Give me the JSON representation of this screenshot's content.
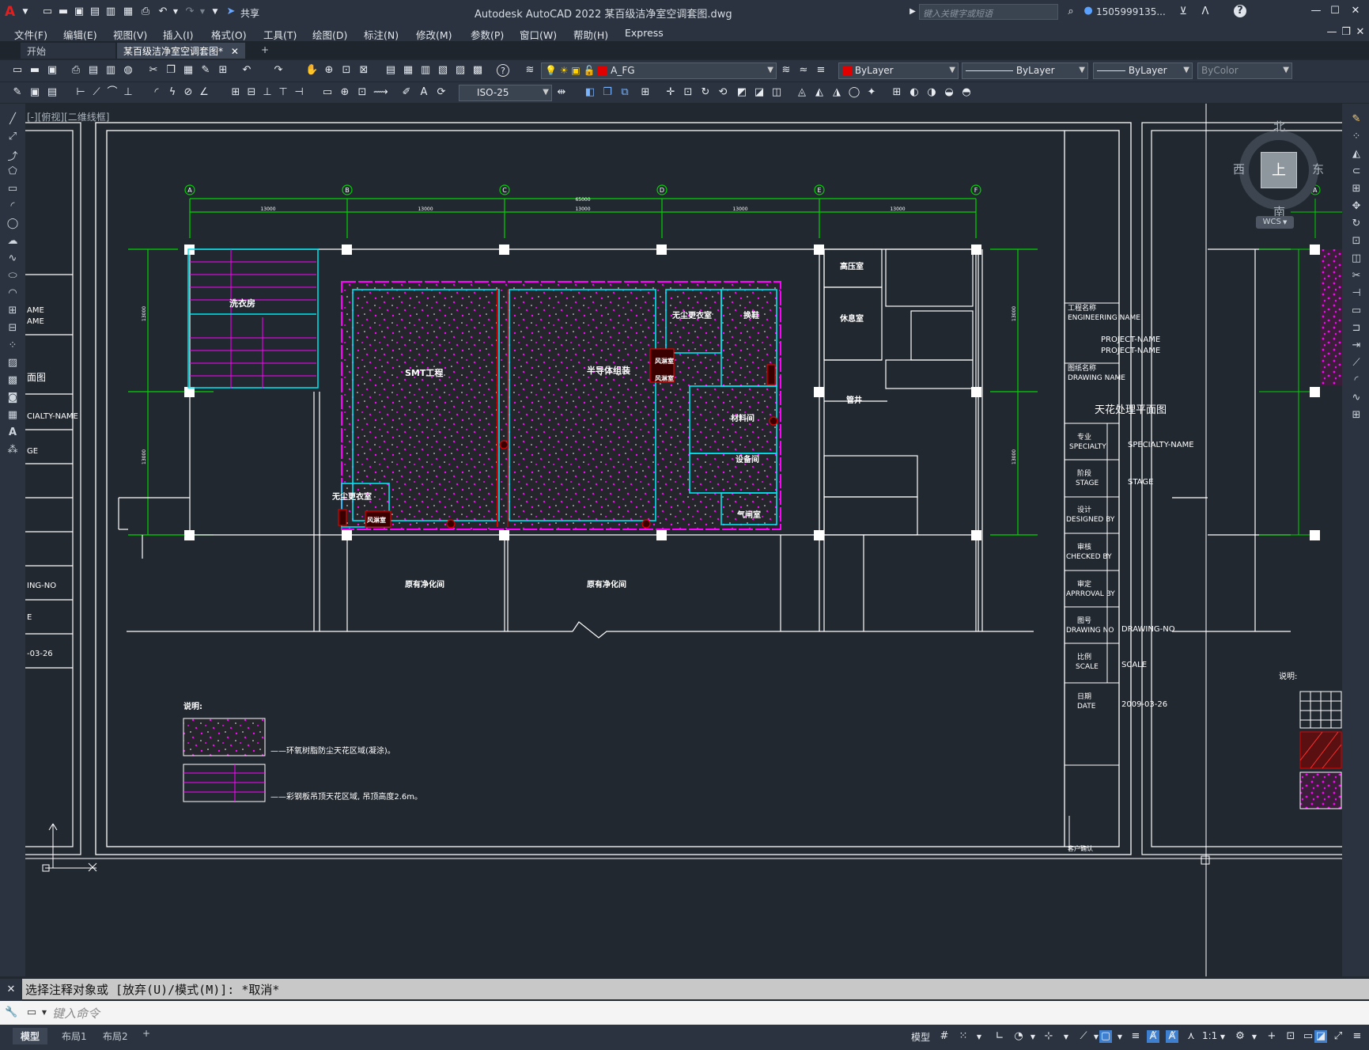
{
  "app": {
    "title": "Autodesk AutoCAD 2022    某百级洁净室空调套图.dwg",
    "share": "共享",
    "search_placeholder": "键入关键字或短语",
    "user": "1505999135..."
  },
  "menu": [
    "文件(F)",
    "编辑(E)",
    "视图(V)",
    "插入(I)",
    "格式(O)",
    "工具(T)",
    "绘图(D)",
    "标注(N)",
    "修改(M)",
    "参数(P)",
    "窗口(W)",
    "帮助(H)",
    "Express"
  ],
  "tabs": {
    "start": "开始",
    "active": "某百级洁净室空调套图*"
  },
  "toolbar": {
    "layer": "A_FG",
    "color": "ByLayer",
    "linetype": "ByLayer",
    "lineweight": "ByLayer",
    "plotstyle": "ByColor",
    "dimstyle": "ISO-25"
  },
  "viewport_label": "[-][俯视][二维线框]",
  "viewcube": {
    "north": "北",
    "south": "南",
    "east": "东",
    "west": "西",
    "top": "上",
    "wcs": "WCS"
  },
  "drawing": {
    "grid_labels": [
      "A",
      "B",
      "C",
      "D",
      "E",
      "F"
    ],
    "total_dim": "65000",
    "span_dims": [
      "13000",
      "13000",
      "13000",
      "13000",
      "13000"
    ],
    "side_dims": [
      "13000",
      "13000"
    ],
    "rooms": {
      "laundry": "洗衣房",
      "smt": "SMT工程",
      "semi": "半导体组装",
      "dust_free_1": "无尘更衣室",
      "shoe": "换鞋",
      "air_shower_1": "风淋室",
      "air_shower_2": "风淋室",
      "material": "材料间",
      "equipment": "设备间",
      "airlock": "气闸室",
      "dust_free_2": "无尘更衣室",
      "air_shower_3": "风淋室",
      "hv": "高压室",
      "rest": "休息室",
      "shaft": "管井",
      "existing_1": "原有净化间",
      "existing_2": "原有净化间"
    },
    "notes_title": "说明:",
    "note1": "——环氧树脂防尘天花区域(凝涂)。",
    "note2": "——彩钢板吊顶天花区域, 吊顶高度2.6m。"
  },
  "titleblock": {
    "eng_cn": "工程名称",
    "eng": "ENGINEERING NAME",
    "project1": "PROJECT-NAME",
    "project2": "PROJECT-NAME",
    "dwg_cn": "图纸名称",
    "dwg": "DRAWING NAME",
    "dwg_title": "天花处理平面图",
    "spec_cn": "专业",
    "spec": "SPECIALTY",
    "spec_val": "SPECIALTY-NAME",
    "stage_cn": "阶段",
    "stage": "STAGE",
    "stage_val": "STAGE",
    "design_cn": "设计",
    "design": "DESIGNED BY",
    "check_cn": "审核",
    "check": "CHECKED BY",
    "approve_cn": "审定",
    "approve": "APRROVAL BY",
    "no_cn": "图号",
    "no": "DRAWING NO",
    "no_val": "DRAWING-NO",
    "scale_cn": "比例",
    "scale": "SCALE",
    "scale_val": "SCALE",
    "date_cn": "日期",
    "date": "DATE",
    "date_val": "2009-03-26",
    "remark": "说明",
    "client": "客户确认"
  },
  "left_sheet": {
    "l1": "AME",
    "l2": "AME",
    "l3": "面图",
    "l4": "CIALTY-NAME",
    "l5": "GE",
    "l6": "ING-NO",
    "l7": "E",
    "l8": "-03-26"
  },
  "right_sheet": {
    "notes": "说明:",
    "grid": "A"
  },
  "command": {
    "history": "选择注释对象或 [放弃(U)/模式(M)]: *取消*",
    "placeholder": "键入命令"
  },
  "layout_tabs": [
    "模型",
    "布局1",
    "布局2"
  ],
  "status": {
    "model": "模型",
    "scale": "1:1"
  },
  "colors": {
    "green": "#00d400",
    "cyan": "#00e5f0",
    "magenta": "#ff00ff",
    "red": "#e00000",
    "white": "#ffffff"
  }
}
